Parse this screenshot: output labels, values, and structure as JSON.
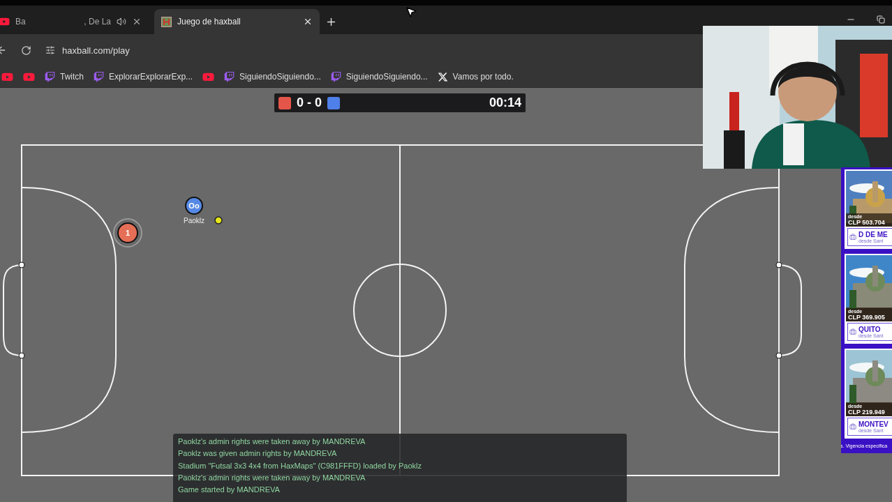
{
  "tabs": [
    {
      "title_parts": [
        "Ba",
        ", De La"
      ],
      "kind": "youtube",
      "audio": true,
      "selected": false
    },
    {
      "title_parts": [
        "Juego de haxball"
      ],
      "kind": "haxball",
      "audio": false,
      "selected": true
    }
  ],
  "address_bar": {
    "url": "haxball.com/play"
  },
  "bookmarks": [
    {
      "kind": "youtube"
    },
    {
      "kind": "youtube"
    },
    {
      "label": "Twitch",
      "kind": "twitch"
    },
    {
      "label": "ExplorarExplorarExp...",
      "kind": "twitch"
    },
    {
      "kind": "youtube"
    },
    {
      "label": "SiguiendoSiguiendo...",
      "kind": "twitch"
    },
    {
      "label": "SiguiendoSiguiendo...",
      "kind": "twitch"
    },
    {
      "label": "Vamos por todo.",
      "kind": "x"
    }
  ],
  "scoreboard": {
    "score": "0 - 0",
    "time": "00:14"
  },
  "players": [
    {
      "kind": "red",
      "avatar": "1"
    },
    {
      "kind": "blue",
      "avatar": "Oo",
      "name": "Paoklz"
    }
  ],
  "chat": [
    {
      "text": "Paoklz's admin rights were taken away by MANDREVA",
      "kind": "system"
    },
    {
      "text": "Paoklz was given admin rights by MANDREVA",
      "kind": "system"
    },
    {
      "text": "Stadium \"Futsal 3x3 4x4 from HaxMaps\" (C981FFFD) loaded by Paoklz",
      "kind": "system"
    },
    {
      "text": "Paoklz's admin rights were taken away by MANDREVA",
      "kind": "system"
    },
    {
      "text": "Game started by MANDREVA",
      "kind": "system"
    }
  ],
  "ads": {
    "cards": [
      {
        "from": "desde",
        "price": "CLP 503.704",
        "title": "D DE ME",
        "subtitle": "desde Sant"
      },
      {
        "from": "desde",
        "price": "CLP 369.905",
        "title": "QUITO",
        "subtitle": "desde Sant"
      },
      {
        "from": "desde",
        "price": "CLP 219.949",
        "title": "MONTEV",
        "subtitle": "desde Sant"
      }
    ],
    "footer": "s. Vigencia especifica"
  }
}
